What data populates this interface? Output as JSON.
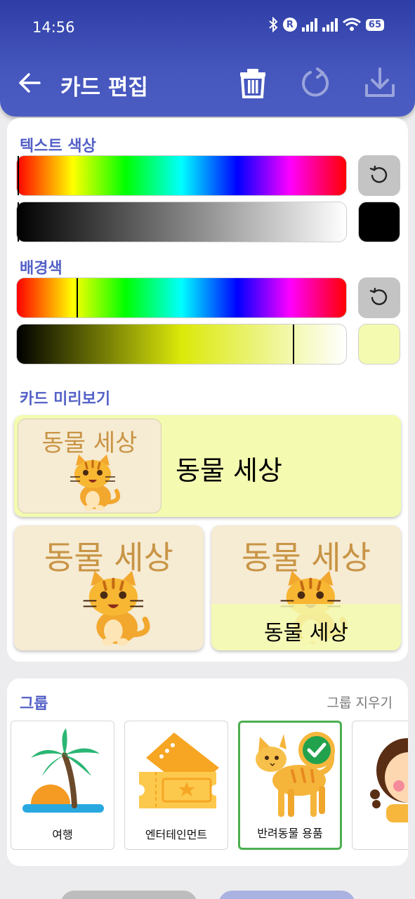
{
  "status": {
    "time": "14:56",
    "battery": "65"
  },
  "appbar": {
    "title": "카드 편집"
  },
  "editor": {
    "text_color_label": "텍스트 색상",
    "bg_color_label": "배경색",
    "preview_label": "카드 미리보기",
    "text_color_hex": "#000000",
    "bg_color_hex": "#f4fbb0"
  },
  "preview": {
    "card_text": "동물 세상"
  },
  "groups": {
    "title": "그룹",
    "clear_label": "그룹 지우기",
    "items": [
      {
        "label": "여행",
        "icon": "palm-beach-icon",
        "selected": false
      },
      {
        "label": "엔터테인먼트",
        "icon": "ticket-icon",
        "selected": false
      },
      {
        "label": "반려동물 용품",
        "icon": "cat-icon",
        "selected": true
      },
      {
        "label": "",
        "icon": "girl-icon",
        "selected": false
      }
    ]
  }
}
